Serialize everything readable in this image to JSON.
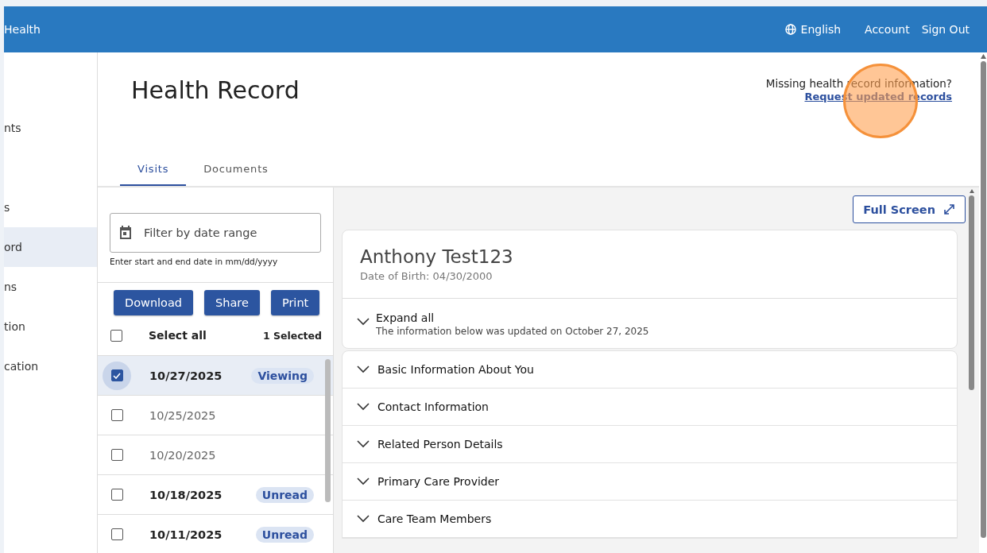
{
  "header": {
    "brand": "Health",
    "language": "English",
    "links": [
      "Account",
      "Sign Out"
    ]
  },
  "sidebar": {
    "items": [
      {
        "label": "nts",
        "selected": false
      },
      {
        "label": "s",
        "selected": false
      },
      {
        "label": "ord",
        "selected": true
      },
      {
        "label": "ns",
        "selected": false
      },
      {
        "label": "tion",
        "selected": false
      },
      {
        "label": "cation",
        "selected": false
      }
    ]
  },
  "page": {
    "title": "Health Record",
    "notice": "Missing health record information?",
    "notice_link": "Request updated records"
  },
  "tabs": [
    {
      "label": "Visits",
      "selected": true
    },
    {
      "label": "Documents",
      "selected": false
    }
  ],
  "filter": {
    "placeholder": "Filter by date range",
    "hint": "Enter start and end date in mm/dd/yyyy"
  },
  "actions": [
    "Download",
    "Share",
    "Print"
  ],
  "select_all": {
    "label": "Select all",
    "checked": false,
    "count": "1 Selected"
  },
  "visits": [
    {
      "date": "10/27/2025",
      "checked": true,
      "selected": true,
      "unread": false,
      "badge": "Viewing"
    },
    {
      "date": "10/25/2025",
      "checked": false,
      "selected": false,
      "unread": false
    },
    {
      "date": "10/20/2025",
      "checked": false,
      "selected": false,
      "unread": false
    },
    {
      "date": "10/18/2025",
      "checked": false,
      "selected": false,
      "unread": true,
      "badge": "Unread"
    },
    {
      "date": "10/11/2025",
      "checked": false,
      "selected": false,
      "unread": true,
      "badge": "Unread"
    }
  ],
  "viewer": {
    "full_screen": "Full Screen",
    "patient": "Anthony Test123",
    "dob": "Date of Birth: 04/30/2000",
    "expand_all": "Expand all",
    "updated": "The information below was updated on October 27, 2025",
    "sections": [
      {
        "label": "Basic Information About You",
        "expanded": false
      },
      {
        "label": "Contact Information",
        "expanded": false
      },
      {
        "label": "Related Person Details",
        "expanded": false
      },
      {
        "label": "Primary Care Provider",
        "expanded": false
      },
      {
        "label": "Care Team Members",
        "expanded": false
      }
    ]
  }
}
